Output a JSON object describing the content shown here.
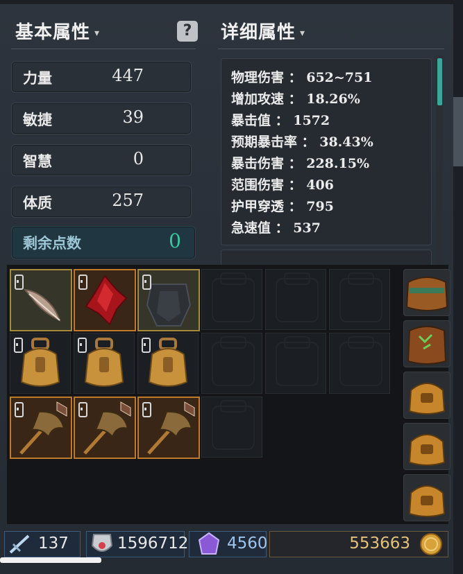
{
  "basic": {
    "title": "基本属性",
    "help": "?",
    "stats": [
      {
        "label": "力量",
        "value": "447"
      },
      {
        "label": "敏捷",
        "value": "39"
      },
      {
        "label": "智慧",
        "value": "0"
      },
      {
        "label": "体质",
        "value": "257"
      }
    ],
    "remaining": {
      "label": "剩余点数",
      "value": "0"
    }
  },
  "detail": {
    "title": "详细属性",
    "lines": [
      "物理伤害 ： 652~751",
      "增加攻速 ： 18.26%",
      "暴击值 ： 1572",
      "预期暴击率 ： 38.43%",
      "暴击伤害 ： 228.15%",
      "范围伤害 ： 406",
      "护甲穿透 ： 795",
      "急速值 ： 537"
    ]
  },
  "inventory": {
    "items": [
      {
        "icon": "feather-icon",
        "rarity": "gold"
      },
      {
        "icon": "red-crystal-icon",
        "rarity": "orange"
      },
      {
        "icon": "dark-armor-icon",
        "rarity": "gold"
      },
      {
        "icon": "backpack-icon",
        "rarity": "none"
      },
      {
        "icon": "backpack-icon",
        "rarity": "none"
      },
      {
        "icon": "backpack-icon",
        "rarity": "none"
      },
      {
        "icon": "dragon-staff-icon",
        "rarity": "orange"
      },
      {
        "icon": "dragon-staff-icon",
        "rarity": "orange"
      },
      {
        "icon": "dragon-staff-icon",
        "rarity": "orange"
      }
    ],
    "bag_tabs": [
      "leather-bag-icon",
      "green-rune-bag-icon",
      "golden-bag-icon",
      "golden-bag-icon",
      "golden-bag-icon"
    ]
  },
  "currency": {
    "skill_points": "137",
    "honor": "1596712",
    "crystal": "4560",
    "gold": "553663"
  },
  "colors": {
    "accent": "#39c7a0",
    "gold_border": "#a88a3c",
    "orange_border": "#c07a2a"
  }
}
